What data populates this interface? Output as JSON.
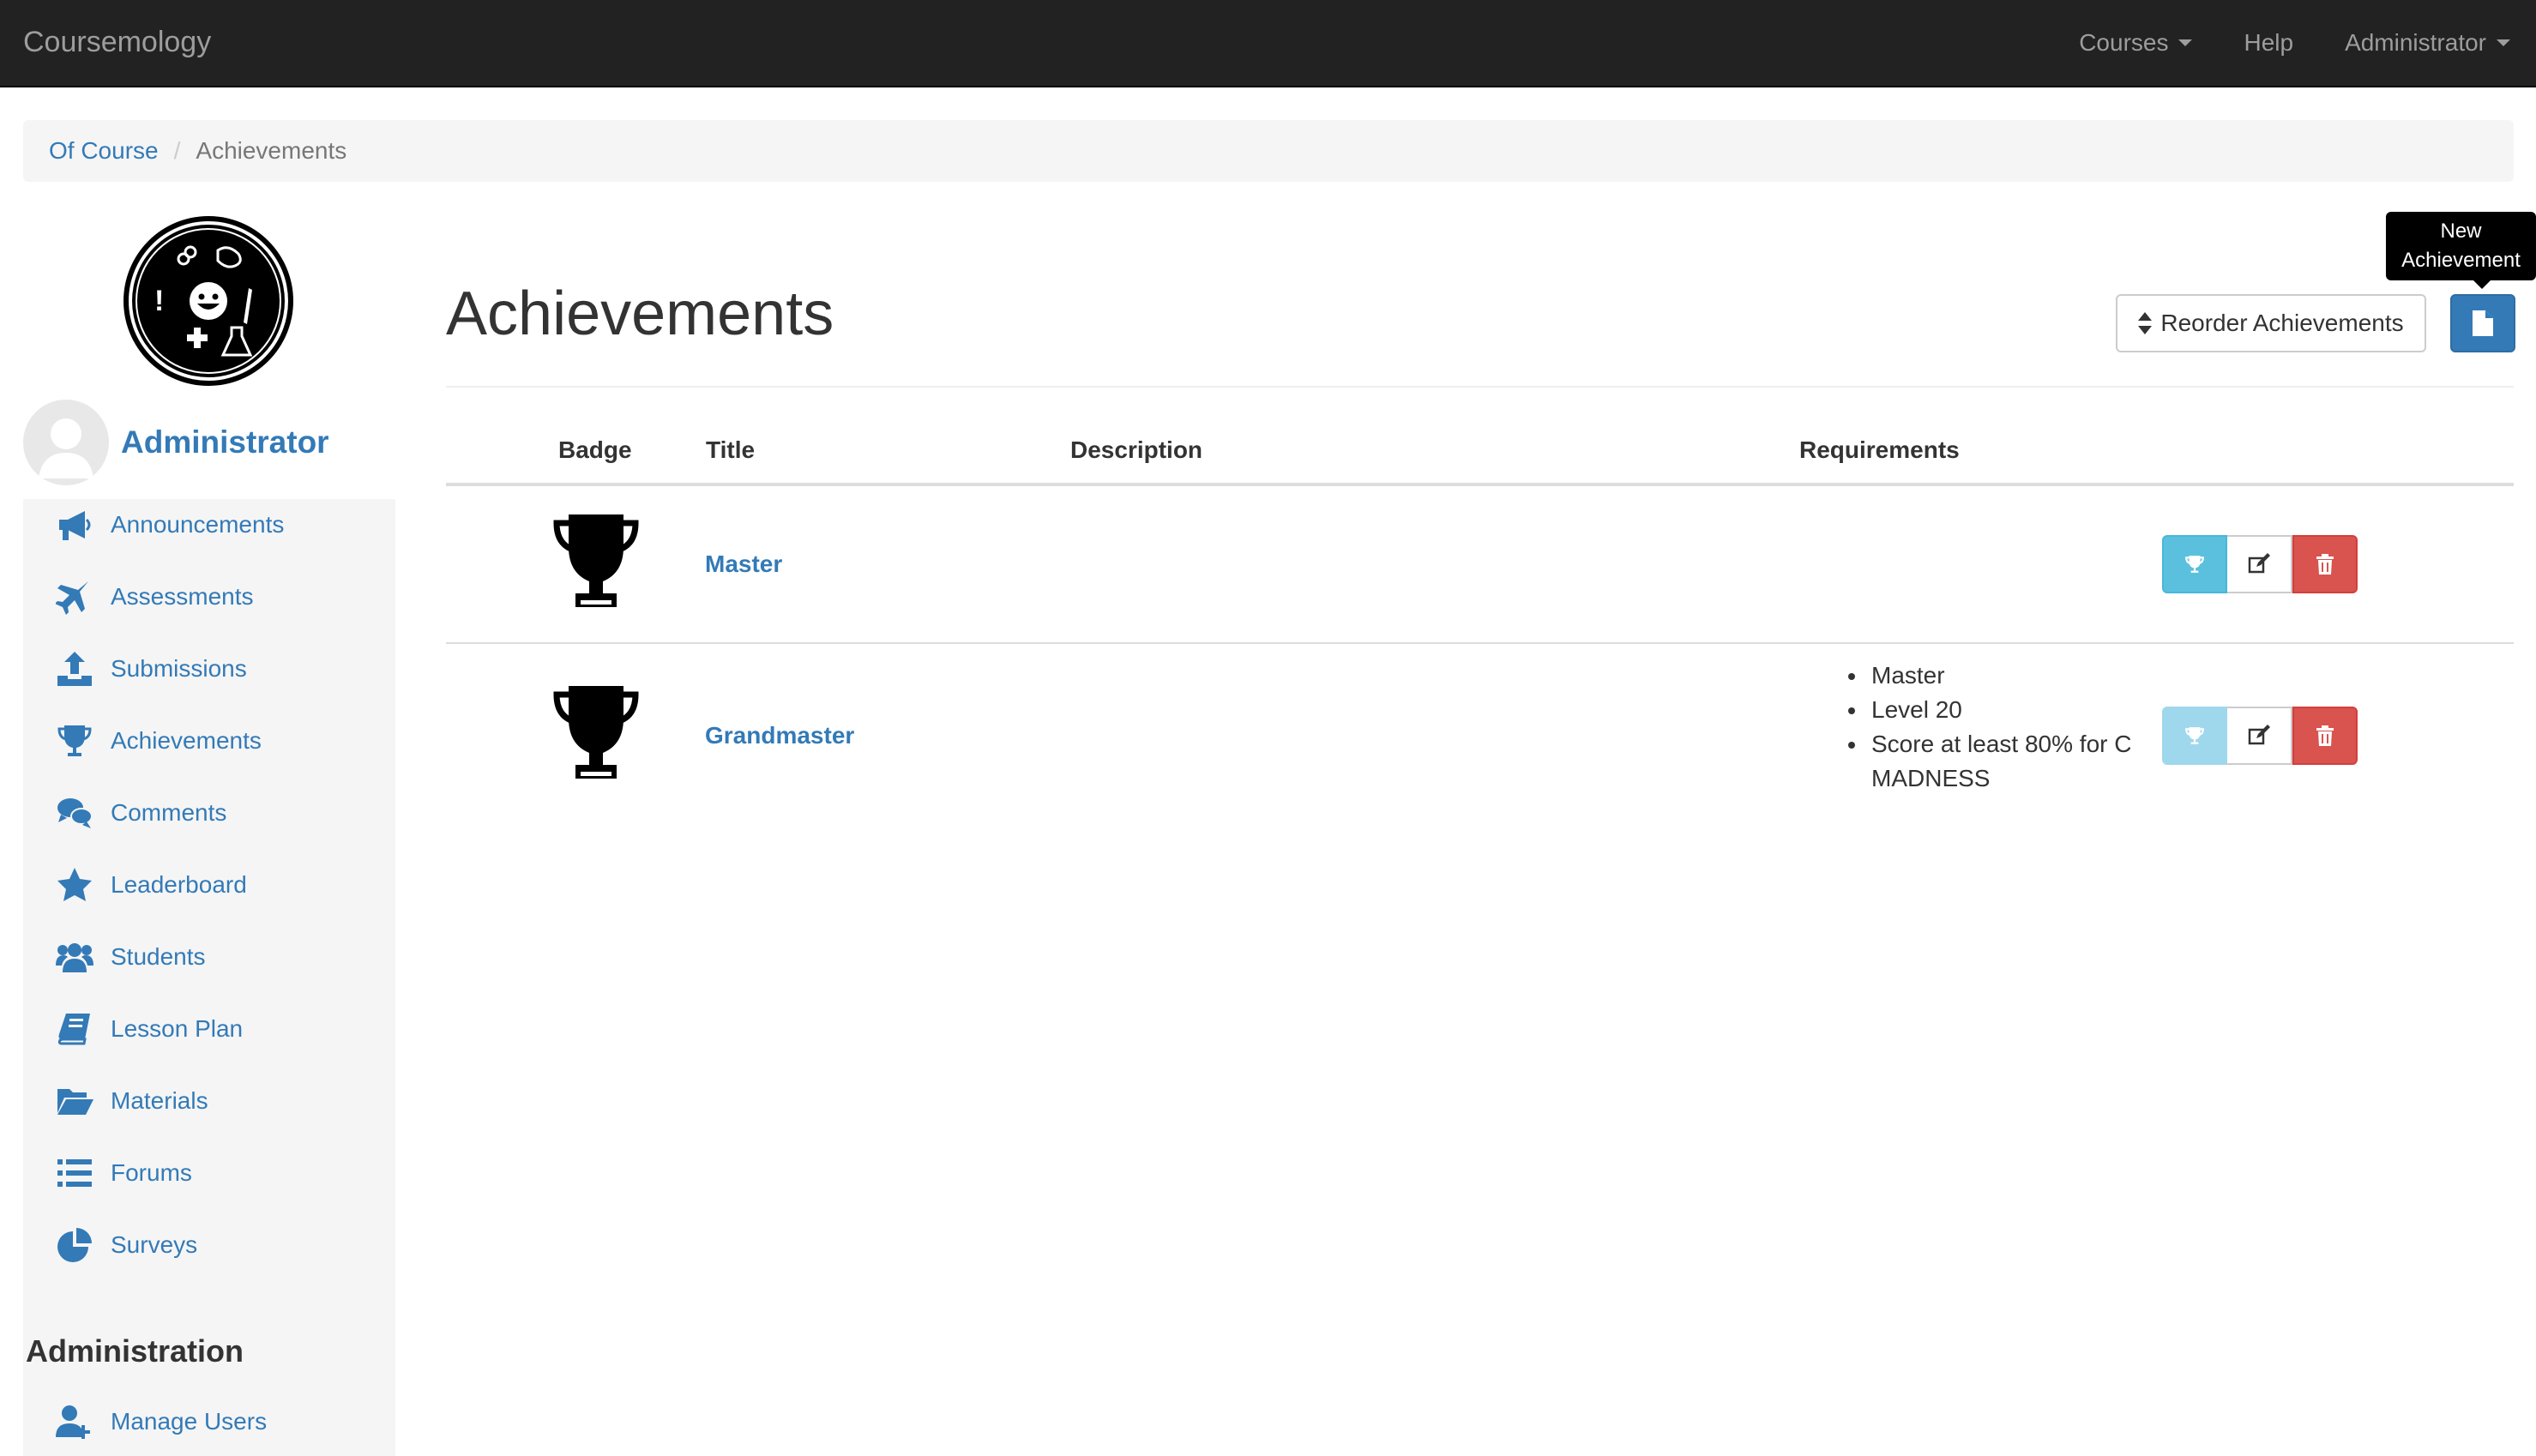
{
  "navbar": {
    "brand": "Coursemology",
    "items": [
      {
        "label": "Courses",
        "caret": true
      },
      {
        "label": "Help",
        "caret": false
      },
      {
        "label": "Administrator",
        "caret": true
      }
    ]
  },
  "breadcrumb": {
    "course": "Of Course",
    "current": "Achievements"
  },
  "sidebar": {
    "user_name": "Administrator",
    "items": [
      {
        "label": "Announcements",
        "icon": "bullhorn-icon"
      },
      {
        "label": "Assessments",
        "icon": "plane-icon"
      },
      {
        "label": "Submissions",
        "icon": "upload-icon"
      },
      {
        "label": "Achievements",
        "icon": "trophy-icon"
      },
      {
        "label": "Comments",
        "icon": "comments-icon"
      },
      {
        "label": "Leaderboard",
        "icon": "star-icon"
      },
      {
        "label": "Students",
        "icon": "users-icon"
      },
      {
        "label": "Lesson Plan",
        "icon": "book-icon"
      },
      {
        "label": "Materials",
        "icon": "folder-open-icon"
      },
      {
        "label": "Forums",
        "icon": "list-icon"
      },
      {
        "label": "Surveys",
        "icon": "pie-chart-icon"
      }
    ],
    "admin_heading": "Administration",
    "admin_items": [
      {
        "label": "Manage Users",
        "icon": "user-plus-icon"
      }
    ]
  },
  "main": {
    "title": "Achievements",
    "reorder_label": "Reorder Achievements",
    "new_tooltip": [
      "New",
      "Achievement"
    ],
    "table": {
      "headers": {
        "badge": "Badge",
        "title": "Title",
        "description": "Description",
        "requirements": "Requirements"
      },
      "rows": [
        {
          "title": "Master",
          "description": "",
          "requirements": [],
          "award_enabled": true
        },
        {
          "title": "Grandmaster",
          "description": "",
          "requirements": [
            "Master",
            "Level 20",
            "Score at least 80% for C MADNESS"
          ],
          "award_enabled": false
        }
      ]
    }
  },
  "colors": {
    "navbar": "#222222",
    "link": "#337ab7",
    "info": "#5bc0de",
    "danger": "#d9534f",
    "primary": "#337ab7"
  }
}
